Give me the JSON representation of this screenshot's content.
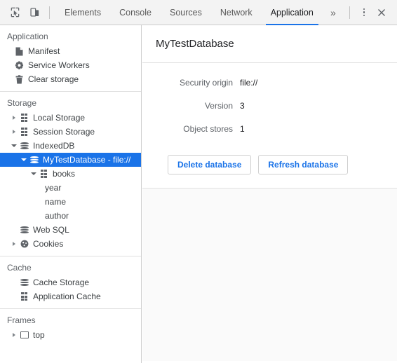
{
  "toolbar": {
    "inspect_icon": "inspect-cursor-icon",
    "device_icon": "device-toolbar-icon",
    "more_tabs_label": "»",
    "menu_icon": "three-dots-menu-icon",
    "close_icon": "close-icon",
    "tabs": [
      {
        "label": "Elements",
        "active": false
      },
      {
        "label": "Console",
        "active": false
      },
      {
        "label": "Sources",
        "active": false
      },
      {
        "label": "Network",
        "active": false
      },
      {
        "label": "Application",
        "active": true
      }
    ]
  },
  "sidebar": {
    "sections": [
      {
        "title": "Application",
        "items": [
          {
            "label": "Manifest",
            "icon": "document-icon",
            "depth": 1,
            "twisty": "none",
            "selected": false
          },
          {
            "label": "Service Workers",
            "icon": "gear-icon",
            "depth": 1,
            "twisty": "none",
            "selected": false
          },
          {
            "label": "Clear storage",
            "icon": "trash-icon",
            "depth": 1,
            "twisty": "none",
            "selected": false
          }
        ]
      },
      {
        "title": "Storage",
        "items": [
          {
            "label": "Local Storage",
            "icon": "table-icon",
            "depth": 1,
            "twisty": "closed",
            "selected": false
          },
          {
            "label": "Session Storage",
            "icon": "table-icon",
            "depth": 1,
            "twisty": "closed",
            "selected": false
          },
          {
            "label": "IndexedDB",
            "icon": "database-icon",
            "depth": 1,
            "twisty": "open",
            "selected": false
          },
          {
            "label": "MyTestDatabase - file://",
            "icon": "database-icon",
            "depth": 2,
            "twisty": "open",
            "selected": true
          },
          {
            "label": "books",
            "icon": "table-icon",
            "depth": 3,
            "twisty": "open",
            "selected": false
          },
          {
            "label": "year",
            "icon": "none",
            "depth": 4,
            "twisty": "none",
            "selected": false
          },
          {
            "label": "name",
            "icon": "none",
            "depth": 4,
            "twisty": "none",
            "selected": false
          },
          {
            "label": "author",
            "icon": "none",
            "depth": 4,
            "twisty": "none",
            "selected": false
          },
          {
            "label": "Web SQL",
            "icon": "database-icon",
            "depth": 1,
            "twisty": "none",
            "selected": false
          },
          {
            "label": "Cookies",
            "icon": "cookie-icon",
            "depth": 1,
            "twisty": "closed",
            "selected": false
          }
        ]
      },
      {
        "title": "Cache",
        "items": [
          {
            "label": "Cache Storage",
            "icon": "database-icon",
            "depth": 1,
            "twisty": "none",
            "selected": false
          },
          {
            "label": "Application Cache",
            "icon": "table-icon",
            "depth": 1,
            "twisty": "none",
            "selected": false
          }
        ]
      },
      {
        "title": "Frames",
        "items": [
          {
            "label": "top",
            "icon": "frame-icon",
            "depth": 1,
            "twisty": "closed",
            "selected": false
          }
        ]
      }
    ]
  },
  "main": {
    "title": "MyTestDatabase",
    "fields": [
      {
        "key": "Security origin",
        "value": "file://"
      },
      {
        "key": "Version",
        "value": "3"
      },
      {
        "key": "Object stores",
        "value": "1"
      }
    ],
    "buttons": [
      {
        "label": "Delete database",
        "name": "delete-database-button"
      },
      {
        "label": "Refresh database",
        "name": "refresh-database-button"
      }
    ]
  },
  "colors": {
    "accent": "#1a73e8",
    "selection": "#1a73e8",
    "toolbar_bg": "#f3f3f3",
    "border": "#cdcdcd",
    "text": "#3c4043",
    "muted_text": "#5f6368"
  }
}
